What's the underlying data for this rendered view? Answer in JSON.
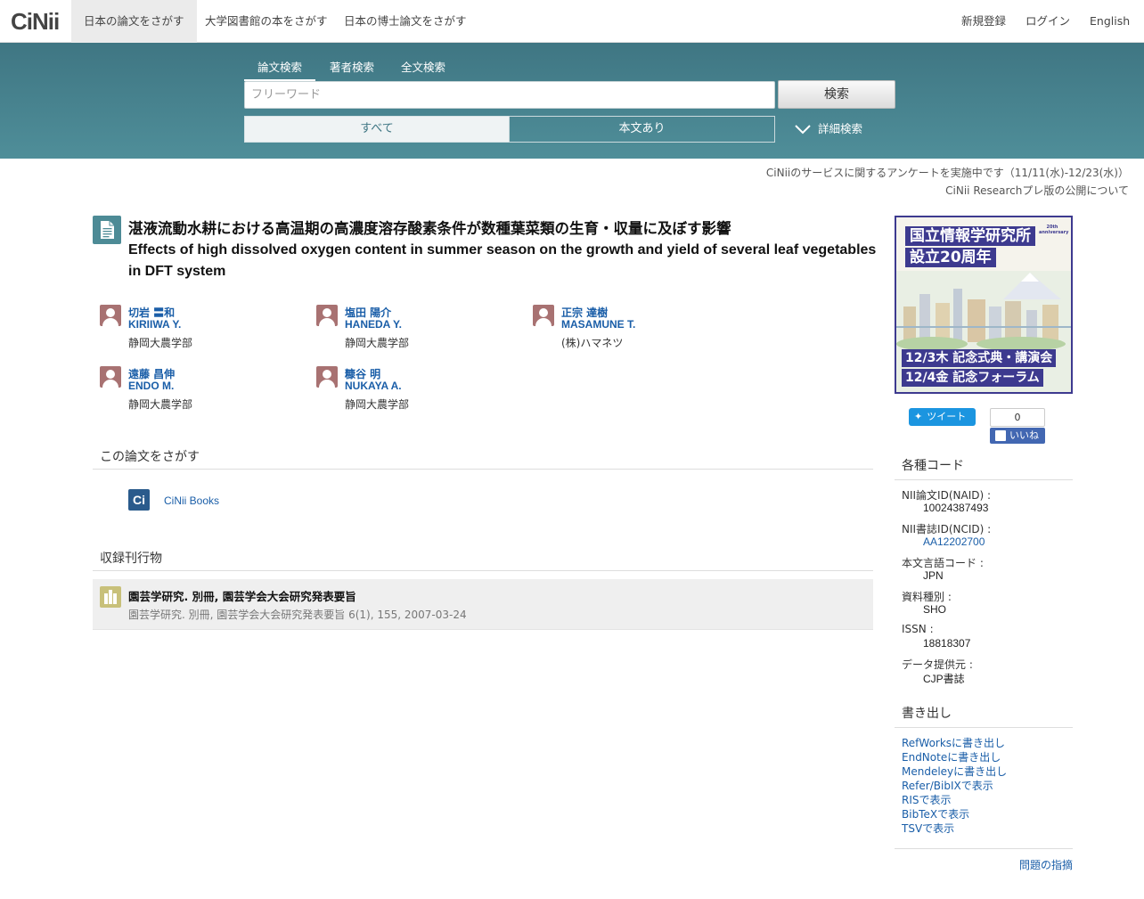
{
  "nav": {
    "logo": "CiNii",
    "tabs": [
      "日本の論文をさがす",
      "大学図書館の本をさがす",
      "日本の博士論文をさがす"
    ],
    "register": "新規登録",
    "login": "ログイン",
    "lang": "English"
  },
  "search": {
    "tabs": [
      "論文検索",
      "著者検索",
      "全文検索"
    ],
    "placeholder": "フリーワード",
    "button": "検索",
    "filter_all": "すべて",
    "filter_fulltext": "本文あり",
    "advanced": "詳細検索"
  },
  "notices": [
    "CiNiiのサービスに関するアンケートを実施中です（11/11(水)-12/23(水)）",
    "CiNii Researchプレ版の公開について"
  ],
  "article": {
    "title_ja": "湛液流動水耕における高温期の高濃度溶存酸素条件が数種葉菜類の生育・収量に及ぼす影響",
    "title_en": "Effects of high dissolved oxygen content in summer season on the growth and yield of several leaf vegetables in DFT system",
    "authors": [
      {
        "name_ja": "切岩 〓和",
        "name_en": "KIRIIWA Y.",
        "affiliation": "静岡大農学部"
      },
      {
        "name_ja": "塩田 陽介",
        "name_en": "HANEDA Y.",
        "affiliation": "静岡大農学部"
      },
      {
        "name_ja": "正宗 達樹",
        "name_en": "MASAMUNE T.",
        "affiliation": "(株)ハマネツ"
      },
      {
        "name_ja": "遠藤 昌伸",
        "name_en": "ENDO M.",
        "affiliation": "静岡大農学部"
      },
      {
        "name_ja": "糠谷 明",
        "name_en": "NUKAYA A.",
        "affiliation": "静岡大農学部"
      }
    ]
  },
  "find": {
    "heading": "この論文をさがす",
    "icon_text": "Ci",
    "link": "CiNii Books"
  },
  "journal": {
    "heading": "収録刊行物",
    "title": "園芸学研究. 別冊, 園芸学会大会研究発表要旨",
    "detail": "園芸学研究. 別冊, 園芸学会大会研究発表要旨 6(1), 155, 2007-03-24"
  },
  "banner": {
    "line1": "国立情報学研究所",
    "line2": "設立20周年",
    "badge": "20th anniversary",
    "event1": "12/3木 記念式典・講演会",
    "event2": "12/4金 記念フォーラム"
  },
  "social": {
    "tweet": "ツイート",
    "like_count": "0",
    "like": "いいね"
  },
  "codes": {
    "heading": "各種コード",
    "items": [
      {
        "label": "NII論文ID(NAID) :",
        "value": "10024387493",
        "link": false
      },
      {
        "label": "NII書誌ID(NCID) :",
        "value": "AA12202700",
        "link": true
      },
      {
        "label": "本文言語コード :",
        "value": "JPN",
        "link": false
      },
      {
        "label": "資料種別 :",
        "value": "SHO",
        "link": false
      },
      {
        "label": "ISSN :",
        "value": "18818307",
        "link": false
      },
      {
        "label": "データ提供元 :",
        "value": "CJP書誌",
        "link": false
      }
    ]
  },
  "export": {
    "heading": "書き出し",
    "items": [
      "RefWorksに書き出し",
      "EndNoteに書き出し",
      "Mendeleyに書き出し",
      "Refer/BibIXで表示",
      "RISで表示",
      "BibTeXで表示",
      "TSVで表示"
    ]
  },
  "report": "問題の指摘",
  "colors": {
    "band": "#4a8591",
    "link": "#1a5ea8",
    "avatar": "#a87272",
    "banner": "#3d3a8f"
  }
}
